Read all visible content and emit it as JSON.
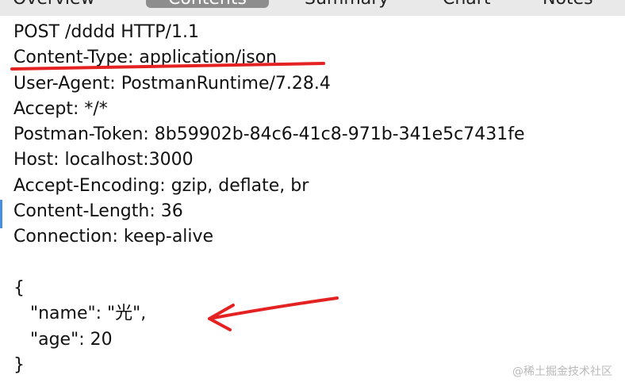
{
  "tabs": [
    {
      "label": "Overview"
    },
    {
      "label": "Contents"
    },
    {
      "label": "Summary"
    },
    {
      "label": "Chart"
    },
    {
      "label": "Notes"
    }
  ],
  "active_tab_index": 1,
  "request_lines": [
    "POST /dddd HTTP/1.1",
    "Content-Type: application/json",
    "User-Agent: PostmanRuntime/7.28.4",
    "Accept: */*",
    "Postman-Token: 8b59902b-84c6-41c8-971b-341e5c7431fe",
    "Host: localhost:3000",
    "Accept-Encoding: gzip, deflate, br",
    "Content-Length: 36",
    "Connection: keep-alive",
    "",
    "{",
    "   \"name\": \"光\",",
    "   \"age\": 20",
    "}"
  ],
  "annotation_color": "#e52222",
  "watermark": "@稀土掘金技术社区"
}
